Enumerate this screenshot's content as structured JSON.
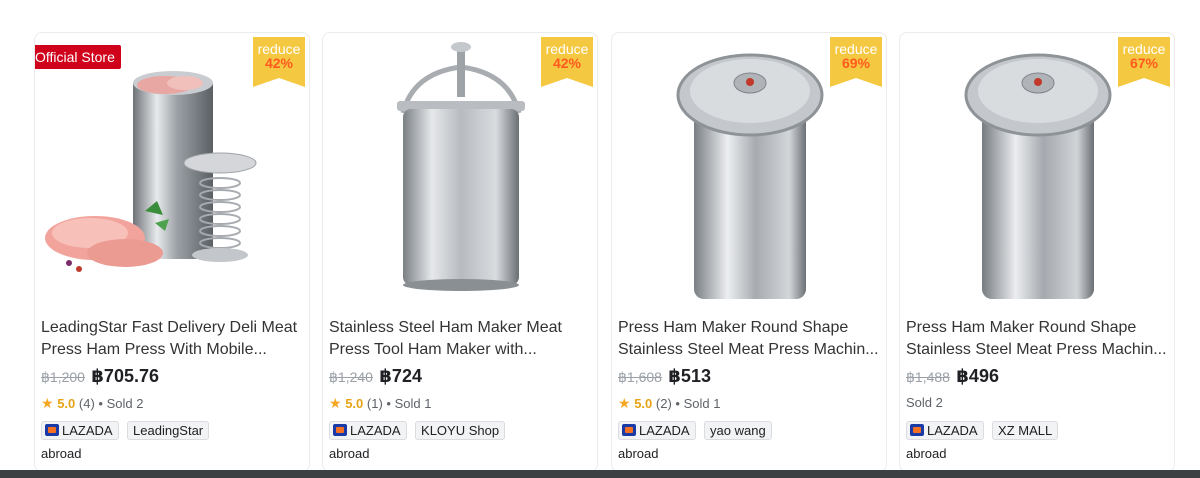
{
  "header": {
    "partial_text": ""
  },
  "products": [
    {
      "badge": "Official Store",
      "ribbon_top": "reduce",
      "ribbon_bottom": "42%",
      "title": "LeadingStar Fast Delivery Deli Meat Press Ham Press With Mobile...",
      "old_price": "฿1,200",
      "new_price": "฿705.76",
      "score": "5.0",
      "review_count": "(4)",
      "sold": "• Sold 2",
      "platform": "LAZADA",
      "store": "LeadingStar",
      "origin": "abroad"
    },
    {
      "ribbon_top": "reduce",
      "ribbon_bottom": "42%",
      "title": "Stainless Steel Ham Maker Meat Press Tool Ham Maker with...",
      "old_price": "฿1,240",
      "new_price": "฿724",
      "score": "5.0",
      "review_count": "(1)",
      "sold": "• Sold 1",
      "platform": "LAZADA",
      "store": "KLOYU Shop",
      "origin": "abroad"
    },
    {
      "ribbon_top": "reduce",
      "ribbon_bottom": "69%",
      "title": "Press Ham Maker Round Shape Stainless Steel Meat Press Machin...",
      "old_price": "฿1,608",
      "new_price": "฿513",
      "score": "5.0",
      "review_count": "(2)",
      "sold": "• Sold 1",
      "platform": "LAZADA",
      "store": "yao wang",
      "origin": "abroad"
    },
    {
      "ribbon_top": "reduce",
      "ribbon_bottom": "67%",
      "title": "Press Ham Maker Round Shape Stainless Steel Meat Press Machin...",
      "old_price": "฿1,488",
      "new_price": "฿496",
      "sold": "Sold 2",
      "platform": "LAZADA",
      "store": "XZ MALL",
      "origin": "abroad"
    }
  ],
  "icons": {
    "star": "star-icon",
    "platform_logo": "lazada-logo-icon"
  },
  "colors": {
    "accent": "#f5c842",
    "discount_text": "#ff5a1f",
    "official_badge": "#d0021b",
    "star": "#f5a623"
  }
}
